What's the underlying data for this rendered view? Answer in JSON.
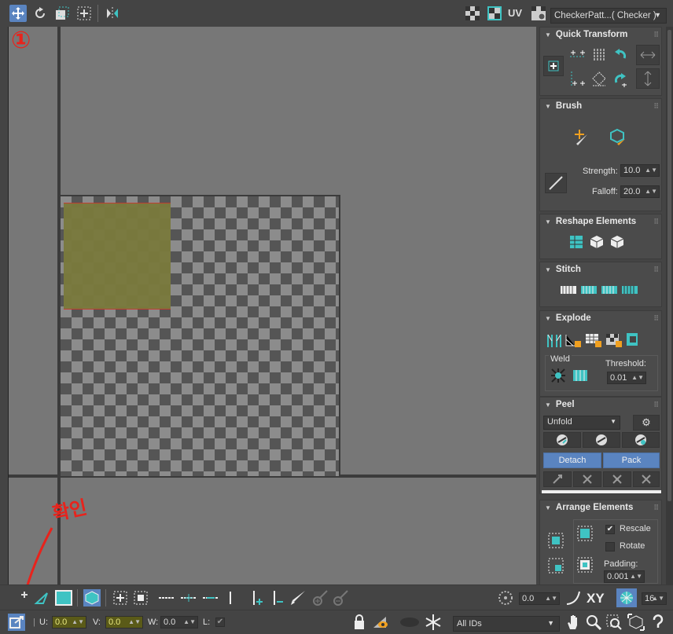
{
  "toolbar": {
    "uv_label": "UV",
    "map_dropdown": "CheckerPatt...( Checker )"
  },
  "annotations": {
    "marker_one": "①",
    "check_note": "확인"
  },
  "quick_transform": {
    "title": "Quick Transform"
  },
  "brush": {
    "title": "Brush",
    "strength_label": "Strength:",
    "strength_value": "10.0",
    "falloff_label": "Falloff:",
    "falloff_value": "20.0"
  },
  "reshape": {
    "title": "Reshape Elements"
  },
  "stitch": {
    "title": "Stitch"
  },
  "explode": {
    "title": "Explode",
    "weld_label": "Weld",
    "threshold_label": "Threshold:",
    "threshold_value": "0.01"
  },
  "peel": {
    "title": "Peel",
    "mode": "Unfold",
    "detach_label": "Detach",
    "pack_label": "Pack"
  },
  "arrange": {
    "title": "Arrange Elements",
    "rescale_label": "Rescale",
    "rescale_checked": true,
    "rotate_label": "Rotate",
    "rotate_checked": false,
    "padding_label": "Padding:",
    "padding_value": "0.001"
  },
  "bottom1": {
    "angle_value": "0.0",
    "xy_label": "XY",
    "grid_value": "16"
  },
  "bottom2": {
    "u_label": "U:",
    "u_value": "0.0",
    "v_label": "V:",
    "v_value": "0.0",
    "w_label": "W:",
    "w_value": "0.0",
    "l_label": "L:",
    "ids_dropdown": "All IDs"
  },
  "colors": {
    "accent_blue": "#5a84c0",
    "teal_icon": "#3fc3c3",
    "annotation_red": "#e8231c",
    "selection_fill": "#7a7a3c"
  }
}
